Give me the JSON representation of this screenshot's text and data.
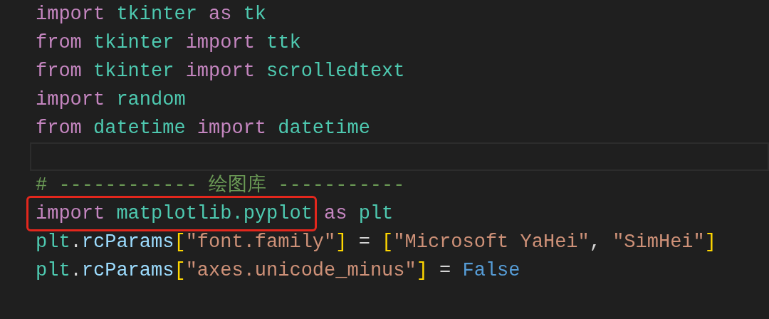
{
  "editor": {
    "lines": [
      {
        "current": false,
        "groups": [
          {
            "boxed": false,
            "tokens": [
              {
                "text": "import",
                "kind": "keyword"
              },
              {
                "text": " tkinter",
                "kind": "module"
              },
              {
                "text": " as",
                "kind": "keyword"
              },
              {
                "text": " tk",
                "kind": "module"
              }
            ]
          }
        ]
      },
      {
        "current": false,
        "groups": [
          {
            "boxed": false,
            "tokens": [
              {
                "text": "from",
                "kind": "keyword"
              },
              {
                "text": " tkinter",
                "kind": "module"
              },
              {
                "text": " import",
                "kind": "keyword"
              },
              {
                "text": " ttk",
                "kind": "module"
              }
            ]
          }
        ]
      },
      {
        "current": false,
        "groups": [
          {
            "boxed": false,
            "tokens": [
              {
                "text": "from",
                "kind": "keyword"
              },
              {
                "text": " tkinter",
                "kind": "module"
              },
              {
                "text": " import",
                "kind": "keyword"
              },
              {
                "text": " scrolledtext",
                "kind": "module"
              }
            ]
          }
        ]
      },
      {
        "current": false,
        "groups": [
          {
            "boxed": false,
            "tokens": [
              {
                "text": "import",
                "kind": "keyword"
              },
              {
                "text": " random",
                "kind": "module"
              }
            ]
          }
        ]
      },
      {
        "current": false,
        "groups": [
          {
            "boxed": false,
            "tokens": [
              {
                "text": "from",
                "kind": "keyword"
              },
              {
                "text": " datetime",
                "kind": "module"
              },
              {
                "text": " import",
                "kind": "keyword"
              },
              {
                "text": " datetime",
                "kind": "module"
              }
            ]
          }
        ]
      },
      {
        "current": true
      },
      {
        "current": false,
        "groups": [
          {
            "boxed": false,
            "tokens": [
              {
                "text": "# ------------ 绘图库 -----------",
                "kind": "comment"
              }
            ]
          }
        ]
      },
      {
        "current": false,
        "groups": [
          {
            "boxed": true,
            "tokens": [
              {
                "text": "import",
                "kind": "keyword"
              },
              {
                "text": " matplotlib.pyplot",
                "kind": "module"
              }
            ]
          },
          {
            "boxed": false,
            "tokens": [
              {
                "text": " as",
                "kind": "keyword"
              },
              {
                "text": " plt",
                "kind": "module"
              }
            ]
          }
        ]
      },
      {
        "current": false,
        "groups": [
          {
            "boxed": false,
            "tokens": [
              {
                "text": "plt",
                "kind": "module"
              },
              {
                "text": ".",
                "kind": "plain"
              },
              {
                "text": "rcParams",
                "kind": "variable"
              },
              {
                "text": "[",
                "kind": "bracket"
              },
              {
                "text": "\"font.family\"",
                "kind": "string"
              },
              {
                "text": "]",
                "kind": "bracket"
              },
              {
                "text": " = ",
                "kind": "plain"
              },
              {
                "text": "[",
                "kind": "bracket"
              },
              {
                "text": "\"Microsoft YaHei\"",
                "kind": "string"
              },
              {
                "text": ", ",
                "kind": "plain"
              },
              {
                "text": "\"SimHei\"",
                "kind": "string"
              },
              {
                "text": "]",
                "kind": "bracket"
              }
            ]
          }
        ]
      },
      {
        "current": false,
        "groups": [
          {
            "boxed": false,
            "tokens": [
              {
                "text": "plt",
                "kind": "module"
              },
              {
                "text": ".",
                "kind": "plain"
              },
              {
                "text": "rcParams",
                "kind": "variable"
              },
              {
                "text": "[",
                "kind": "bracket"
              },
              {
                "text": "\"axes.unicode_minus\"",
                "kind": "string"
              },
              {
                "text": "]",
                "kind": "bracket"
              },
              {
                "text": " = ",
                "kind": "plain"
              },
              {
                "text": "False",
                "kind": "constant"
              }
            ]
          }
        ]
      }
    ]
  }
}
